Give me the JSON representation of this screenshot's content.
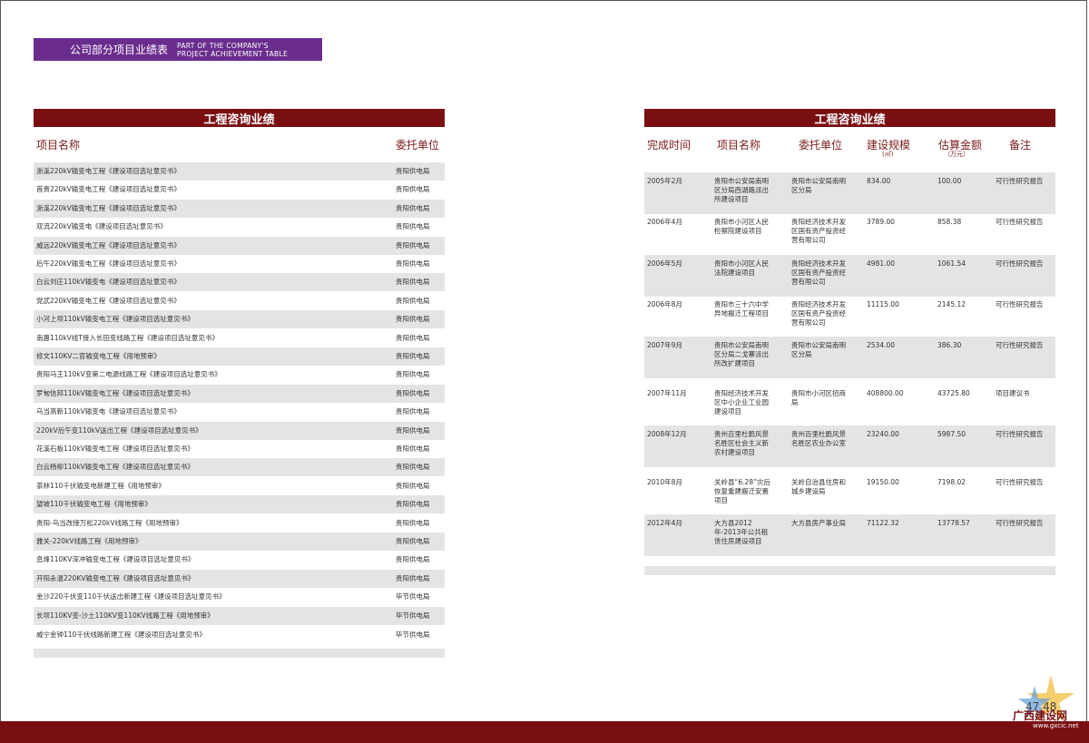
{
  "header": {
    "title_zh": "公司部分项目业绩表",
    "title_en_line1": "PART OF THE COMPANY'S",
    "title_en_line2": "PROJECT ACHIEVEMENT TABLE"
  },
  "left_table": {
    "banner": "工程咨询业绩",
    "columns": [
      "项目名称",
      "委托单位"
    ],
    "rows": [
      [
        "浙溪220kV输变电工程《建设项目选址意见书》",
        "贵阳供电局"
      ],
      [
        "首贵220kV输变电工程《建设项目选址意见书》",
        "贵阳供电局"
      ],
      [
        "浙溪220kV输变电工程《建设项目选址意见书》",
        "贵阳供电局"
      ],
      [
        "双流220kV输变电《建设项目选址意见书》",
        "贵阳供电局"
      ],
      [
        "威远220kV输变电工程《建设项目选址意见书》",
        "贵阳供电局"
      ],
      [
        "后午220kV输变电工程《建设项目选址意见书》",
        "贵阳供电局"
      ],
      [
        "白云刘庄110kV输变电《建设项目选址意见书》",
        "贵阳供电局"
      ],
      [
        "党武220kV输变电工程《建设项目选址意见书》",
        "贵阳供电局"
      ],
      [
        "小河上坝110kV输变电工程《建设项目选址意见书》",
        "贵阳供电局"
      ],
      [
        "南惠110kV线T接入长田变线路工程《建设项目选址意见书》",
        "贵阳供电局"
      ],
      [
        "修文110KV二官输变电工程《用地预审》",
        "贵阳供电局"
      ],
      [
        "贵阳马王110kV变第二电源线路工程《建设项目选址意见书》",
        "贵阳供电局"
      ],
      [
        "罗甸信邦110kV输变电工程《建设项目选址意见书》",
        "贵阳供电局"
      ],
      [
        "乌当高新110kV输变电《建设项目选址意见书》",
        "贵阳供电局"
      ],
      [
        "220kV后午变110kV送出工程《建设项目选址意见书》",
        "贵阳供电局"
      ],
      [
        "花溪石板110kV输变电工程《建设项目选址意见书》",
        "贵阳供电局"
      ],
      [
        "白云杨柳110kV输变电工程《建设项目选址意见书》",
        "贵阳供电局"
      ],
      [
        "茶林110千伏输变电新建工程《用地预审》",
        "贵阳供电局"
      ],
      [
        "望坡110千伏输变电工程《用地预审》",
        "贵阳供电局"
      ],
      [
        "贵阳-乌当改接万松220kV线路工程《用地预审》",
        "贵阳供电局"
      ],
      [
        "雅关-220kV线路工程《用地预审》",
        "贵阳供电局"
      ],
      [
        "息烽110KV深冲输变电工程《建设项目选址意见书》",
        "贵阳供电局"
      ],
      [
        "开阳永温220KV输变电工程《建设项目选址意见书》",
        "贵阳供电局"
      ],
      [
        "金沙220千伏变110千伏送出新建工程《建设项目选址意见书》",
        "毕节供电局"
      ],
      [
        "长坝110KV变-沙土110KV变110KV线路工程《用地预审》",
        "毕节供电局"
      ],
      [
        "威宁金钟110千伏线路新建工程《建设项目选址意见书》",
        "毕节供电局"
      ]
    ]
  },
  "right_table": {
    "banner": "工程咨询业绩",
    "columns": [
      "完成时间",
      "项目名称",
      "委托单位",
      "建设规模",
      "估算金额",
      "备注"
    ],
    "scale_unit": "(㎡)",
    "amount_unit": "（万元）",
    "rows": [
      [
        "2005年2月",
        "贵阳市公安局南明区分局西湖路派出所建设项目",
        "贵阳市公安局南明区分局",
        "834.00",
        "100.00",
        "可行性研究报告"
      ],
      [
        "2006年4月",
        "贵阳市小河区人民检察院建设项目",
        "贵阳经济技术开发区国有资产投资经营有限公司",
        "3789.00",
        "858.38",
        "可行性研究报告"
      ],
      [
        "2006年5月",
        "贵阳市小河区人民法院建设项目",
        "贵阳经济技术开发区国有资产投资经营有限公司",
        "4981.00",
        "1061.54",
        "可行性研究报告"
      ],
      [
        "2006年8月",
        "贵阳市三十六中学异地搬迁工程项目",
        "贵阳经济技术开发区国有资产投资经营有限公司",
        "11115.00",
        "2145.12",
        "可行性研究报告"
      ],
      [
        "2007年9月",
        "贵阳市公安局南明区分局二戈寨派出所改扩建项目",
        "贵阳市公安局南明区分局",
        "2534.00",
        "386.30",
        "可行性研究报告"
      ],
      [
        "2007年11月",
        "贵阳经济技术开发区中小企业工业园建设项目",
        "贵阳市小河区招商局",
        "408800.00",
        "43725.80",
        "项目建议书"
      ],
      [
        "2008年12月",
        "贵州百里杜鹃风景名胜区社会主义新农村建设项目",
        "贵州百里杜鹃风景名胜区农业办公室",
        "23240.00",
        "5987.50",
        "可行性研究报告"
      ],
      [
        "2010年8月",
        "关岭县“6.28”灾后恢复重建搬迁安置项目",
        "关岭自治县住房和城乡建设局",
        "19150.00",
        "7198.02",
        "可行性研究报告"
      ],
      [
        "2012年4月",
        "大方县2012年-2013年公共租赁住房建设项目",
        "大方县房产事业局",
        "71122.32",
        "13778.57",
        "可行性研究报告"
      ]
    ]
  },
  "footer": {
    "page_numbers": "47  48",
    "logo_text": "广西建设网",
    "logo_url": "www.gxcic.net",
    "brand_color": "#7a0f12",
    "accent_color": "#6a2d8e"
  }
}
